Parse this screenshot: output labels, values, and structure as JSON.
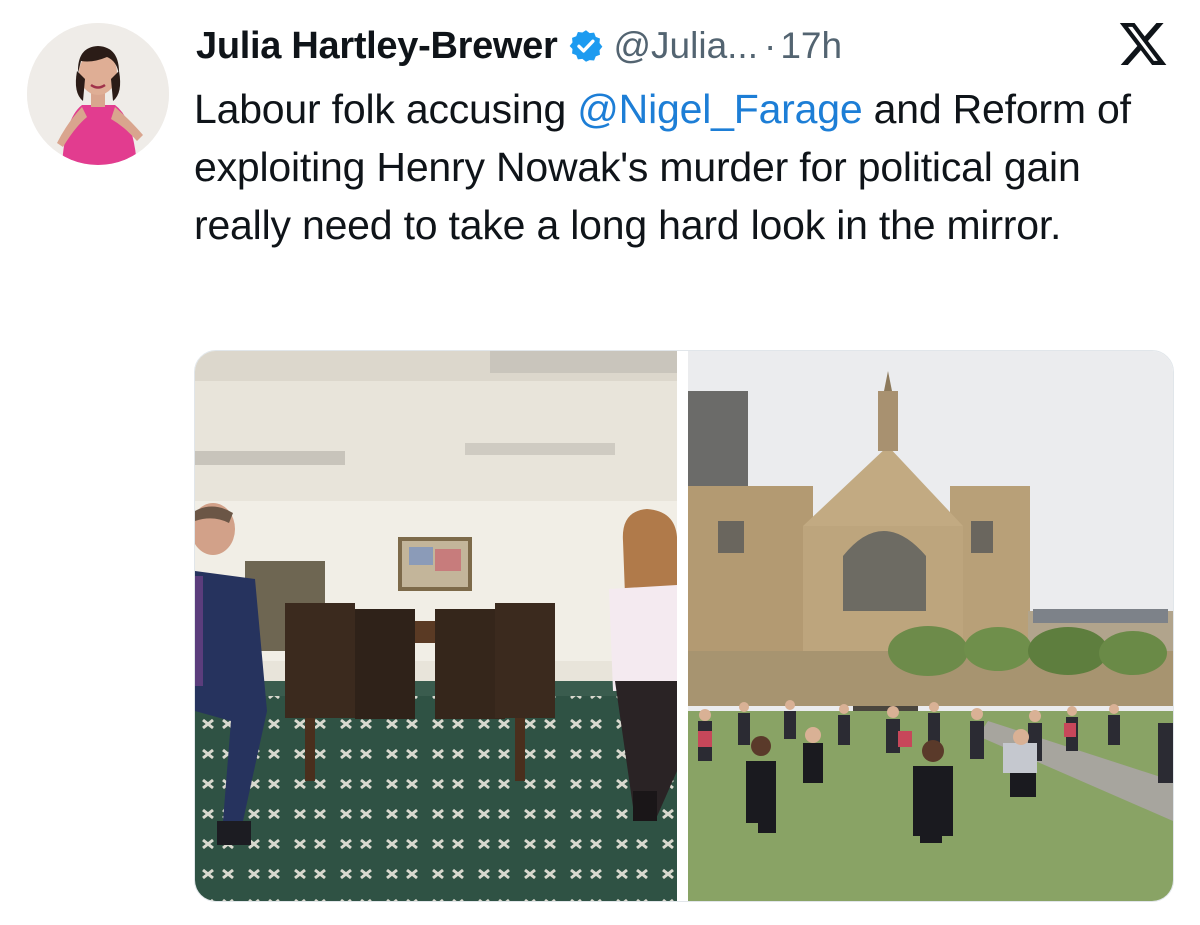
{
  "tweet": {
    "author_name": "Julia Hartley-Brewer",
    "handle": "@Julia...",
    "separator": "·",
    "time": "17h",
    "text_before": "Labour folk accusing ",
    "mention": "@Nigel_Farage",
    "text_after": " and Reform of exploiting Henry Nowak's murder for political gain really need to take a long hard look in the mirror."
  },
  "icons": {
    "verified": "verified-badge-icon",
    "platform": "x-logo-icon"
  },
  "colors": {
    "mention": "#1d7ed6",
    "secondary_text": "#536471",
    "verified_badge": "#1d9bf0"
  },
  "media": {
    "count": 2
  }
}
